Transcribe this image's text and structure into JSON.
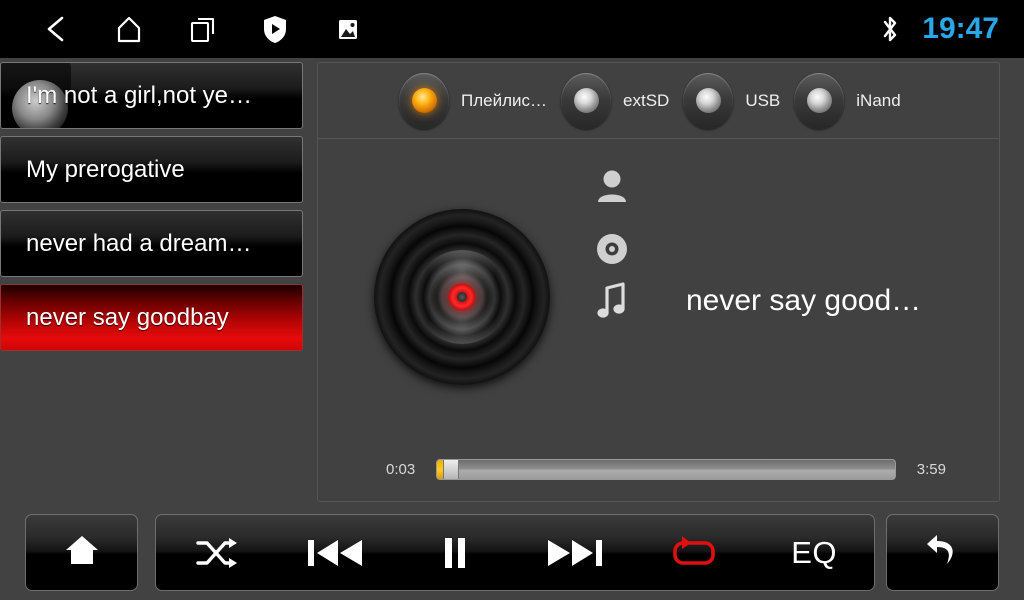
{
  "statusbar": {
    "icons": [
      {
        "name": "back-icon",
        "label": "Back"
      },
      {
        "name": "home-icon",
        "label": "Home"
      },
      {
        "name": "recent-apps-icon",
        "label": "Recent apps"
      },
      {
        "name": "shield-play-icon",
        "label": "Security player"
      },
      {
        "name": "gallery-icon",
        "label": "Gallery"
      }
    ],
    "bluetooth_icon": "bluetooth-icon",
    "clock": "19:47",
    "clock_color": "#29a7e8"
  },
  "playlist": {
    "items": [
      {
        "title": "I'm not a girl,not ye…",
        "selected": false,
        "pressed": true
      },
      {
        "title": "My prerogative",
        "selected": false,
        "pressed": false
      },
      {
        "title": "never had a dream…",
        "selected": false,
        "pressed": false
      },
      {
        "title": "never say goodbay",
        "selected": true,
        "pressed": false
      }
    ],
    "selected_color": "#e60a0a"
  },
  "sources": {
    "items": [
      {
        "label": "Плейлис…",
        "selected": true
      },
      {
        "label": "extSD",
        "selected": false
      },
      {
        "label": "USB",
        "selected": false
      },
      {
        "label": "iNand",
        "selected": false
      }
    ],
    "active_led_color": "#ffb515"
  },
  "now_playing": {
    "album_art_icon": "vinyl-disc-art",
    "artist_icon": "person-icon",
    "artist": "",
    "album_icon": "disc-icon",
    "album": "",
    "title_icon": "music-note-icon",
    "title": "never say good…"
  },
  "progress": {
    "elapsed": "0:03",
    "total": "3:59",
    "percent": 1.3,
    "fill_color": "#ffcc22"
  },
  "controls": {
    "home": {
      "label": "Home",
      "icon": "home-icon"
    },
    "shuffle": {
      "label": "Shuffle",
      "icon": "shuffle-icon",
      "active": false
    },
    "previous": {
      "label": "Previous track",
      "icon": "previous-icon"
    },
    "play_pause": {
      "label": "Pause",
      "icon": "pause-icon"
    },
    "next": {
      "label": "Next track",
      "icon": "next-icon"
    },
    "repeat": {
      "label": "Repeat",
      "icon": "repeat-icon",
      "active": true,
      "active_color": "#e01010"
    },
    "eq": {
      "label": "EQ",
      "icon": "equalizer-label"
    },
    "back": {
      "label": "Back",
      "icon": "return-arrow-icon"
    }
  }
}
